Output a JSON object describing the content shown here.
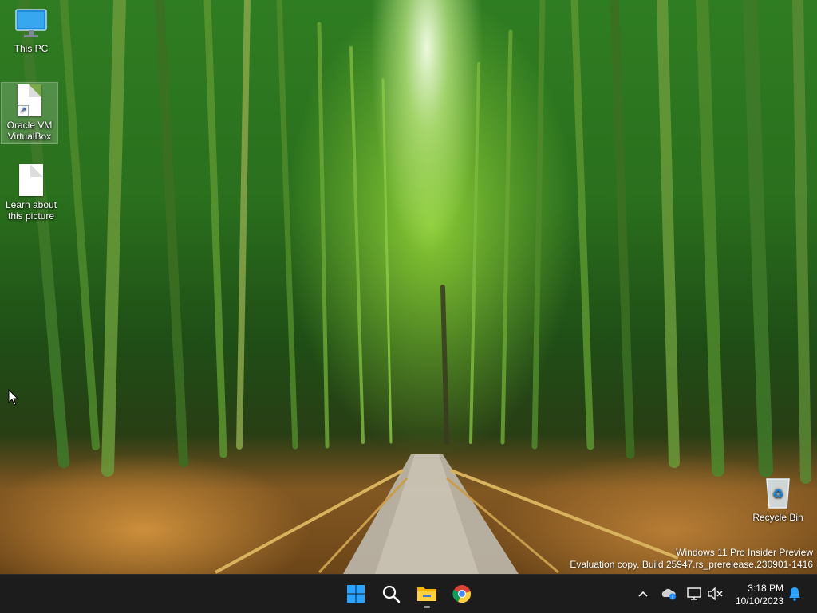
{
  "desktop": {
    "icons": [
      {
        "label": "This PC"
      },
      {
        "label": "Oracle VM VirtualBox"
      },
      {
        "label": "Learn about this picture"
      },
      {
        "label": "Recycle Bin"
      }
    ],
    "watermark": {
      "line1": "Windows 11 Pro Insider Preview",
      "line2": "Evaluation copy. Build 25947.rs_prerelease.230901-1416"
    }
  },
  "taskbar": {
    "pinned": [
      {
        "icon": "windows-start-icon"
      },
      {
        "icon": "search-icon"
      },
      {
        "icon": "file-explorer-icon"
      },
      {
        "icon": "chrome-icon"
      }
    ],
    "tray": {
      "icons": [
        "chevron-up-icon",
        "onedrive-icon",
        "network-icon",
        "volume-muted-icon",
        "notification-bell-icon"
      ]
    },
    "clock": {
      "time": "3:18 PM",
      "date": "10/10/2023"
    }
  },
  "colors": {
    "taskbar_bg": "#1c1c1c",
    "accent_blue": "#1a8cff"
  }
}
